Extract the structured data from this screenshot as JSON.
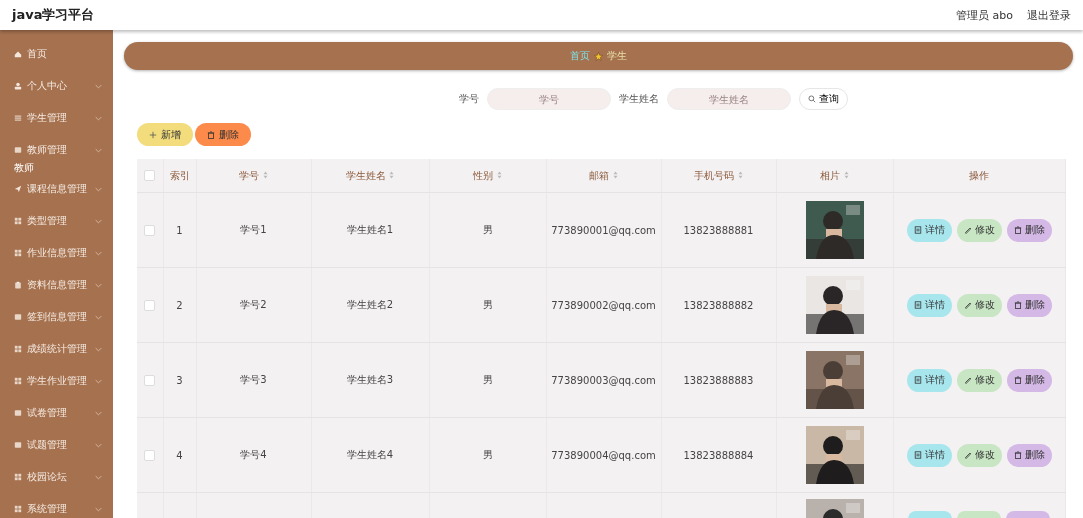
{
  "header": {
    "title": "java学习平台",
    "user": "管理员 abo",
    "logout": "退出登录"
  },
  "sidebar": {
    "items": [
      {
        "label": "首页",
        "expandable": false
      },
      {
        "label": "个人中心",
        "expandable": true
      },
      {
        "label": "学生管理",
        "expandable": true
      },
      {
        "label": "教师管理",
        "expandable": true,
        "note": "教师"
      },
      {
        "label": "课程信息管理",
        "expandable": true
      },
      {
        "label": "类型管理",
        "expandable": true
      },
      {
        "label": "作业信息管理",
        "expandable": true
      },
      {
        "label": "资料信息管理",
        "expandable": true
      },
      {
        "label": "签到信息管理",
        "expandable": true
      },
      {
        "label": "成绩统计管理",
        "expandable": true
      },
      {
        "label": "学生作业管理",
        "expandable": true
      },
      {
        "label": "试卷管理",
        "expandable": true
      },
      {
        "label": "试题管理",
        "expandable": true
      },
      {
        "label": "校园论坛",
        "expandable": true
      },
      {
        "label": "系统管理",
        "expandable": true
      }
    ]
  },
  "breadcrumb": [
    "首页",
    "学生"
  ],
  "search": {
    "fields": [
      {
        "label": "学号",
        "placeholder": "学号"
      },
      {
        "label": "学生姓名",
        "placeholder": "学生姓名"
      }
    ],
    "button": "查询"
  },
  "toolbar": [
    {
      "label": "新增",
      "kind": "add"
    },
    {
      "label": "删除",
      "kind": "delete"
    }
  ],
  "table": {
    "select_all": {
      "checked": false
    },
    "columns": [
      {
        "label": "索引",
        "sortable": false
      },
      {
        "label": "学号",
        "sortable": true
      },
      {
        "label": "学生姓名",
        "sortable": true
      },
      {
        "label": "性别",
        "sortable": true
      },
      {
        "label": "邮箱",
        "sortable": true
      },
      {
        "label": "手机号码",
        "sortable": true
      },
      {
        "label": "相片",
        "sortable": true
      },
      {
        "label": "操作",
        "sortable": false
      }
    ],
    "rows": [
      {
        "checked": false,
        "cells": [
          "1",
          "学号1",
          "学生姓名1",
          "男",
          "773890001@qq.com",
          "13823888881"
        ],
        "actions": [
          {
            "label": "详情",
            "kind": "detail"
          },
          {
            "label": "修改",
            "kind": "edit"
          },
          {
            "label": "删除",
            "kind": "delete"
          }
        ]
      },
      {
        "checked": false,
        "cells": [
          "2",
          "学号2",
          "学生姓名2",
          "男",
          "773890002@qq.com",
          "13823888882"
        ],
        "actions": [
          {
            "label": "详情",
            "kind": "detail"
          },
          {
            "label": "修改",
            "kind": "edit"
          },
          {
            "label": "删除",
            "kind": "delete"
          }
        ]
      },
      {
        "checked": false,
        "cells": [
          "3",
          "学号3",
          "学生姓名3",
          "男",
          "773890003@qq.com",
          "13823888883"
        ],
        "actions": [
          {
            "label": "详情",
            "kind": "detail"
          },
          {
            "label": "修改",
            "kind": "edit"
          },
          {
            "label": "删除",
            "kind": "delete"
          }
        ]
      },
      {
        "checked": false,
        "cells": [
          "4",
          "学号4",
          "学生姓名4",
          "男",
          "773890004@qq.com",
          "13823888884"
        ],
        "actions": [
          {
            "label": "详情",
            "kind": "detail"
          },
          {
            "label": "修改",
            "kind": "edit"
          },
          {
            "label": "删除",
            "kind": "delete"
          }
        ]
      },
      {
        "cells": [],
        "actions": [
          {
            "kind": "detail"
          },
          {
            "kind": "edit"
          },
          {
            "kind": "delete"
          }
        ]
      }
    ]
  }
}
